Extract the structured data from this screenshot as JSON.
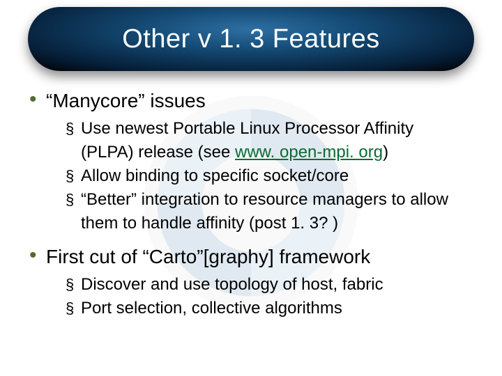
{
  "title": "Other v1.3 Features",
  "title_display": "Other v 1. 3 Features",
  "bullets": [
    {
      "label": "“Manycore” issues",
      "sub": [
        {
          "pre": "Use newest Portable Linux Processor Affinity (PLPA) release (see ",
          "link_text": "www. open-mpi. org",
          "link_display": "www.open-mpi.org",
          "post": ")"
        },
        {
          "text": "Allow binding to specific socket/core"
        },
        {
          "text": "“Better” integration to resource managers to allow them to handle affinity (post 1. 3? )"
        }
      ]
    },
    {
      "label": "First cut of “Carto”[graphy] framework",
      "sub": [
        {
          "text": "Discover and use topology of host, fabric"
        },
        {
          "text": "Port selection, collective algorithms"
        }
      ]
    }
  ]
}
